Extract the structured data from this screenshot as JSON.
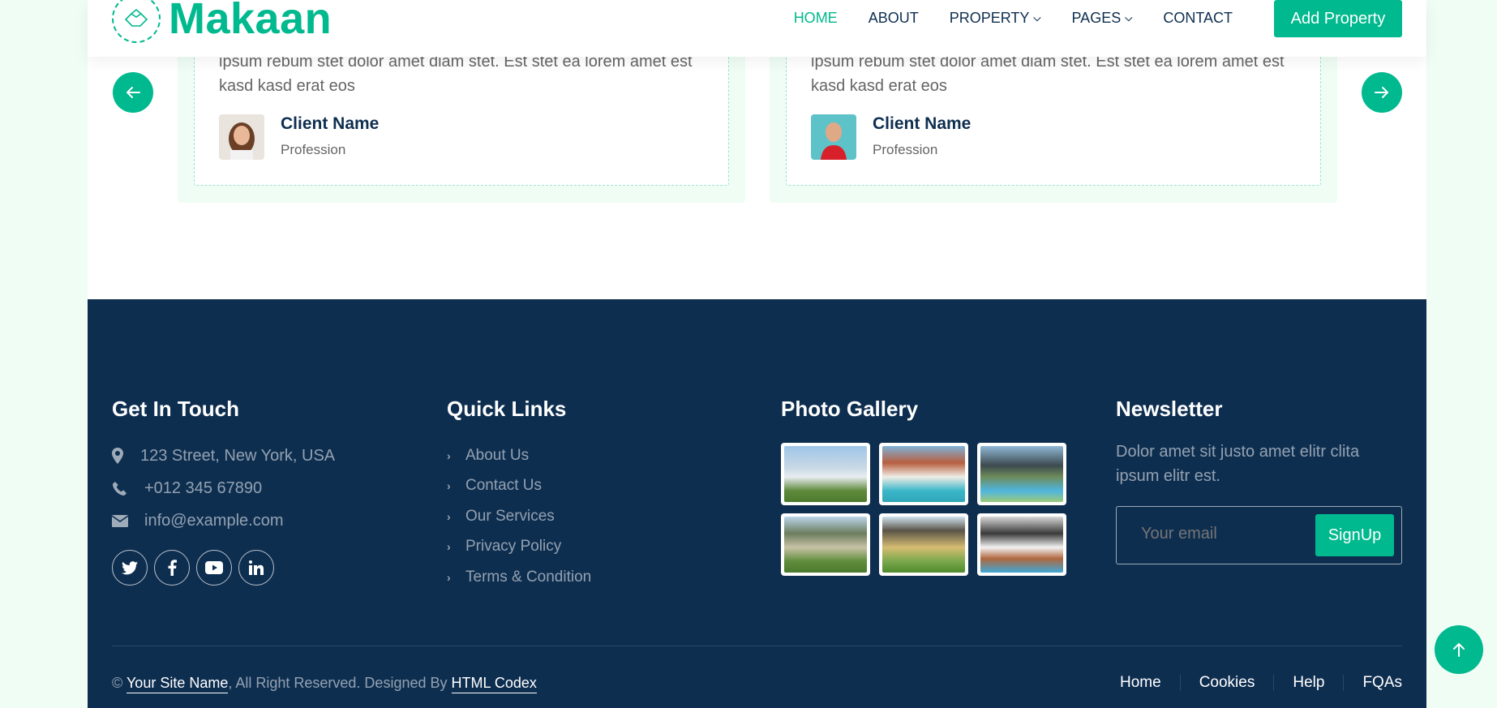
{
  "brand": {
    "name": "Makaan"
  },
  "nav": {
    "links": [
      "HOME",
      "ABOUT",
      "PROPERTY",
      "PAGES",
      "CONTACT"
    ],
    "add_property": "Add Property"
  },
  "testimonials": [
    {
      "text": "ipsum rebum stet dolor amet diam stet. Est stet ea lorem amet est kasd kasd erat eos",
      "name": "Client Name",
      "profession": "Profession"
    },
    {
      "text": "ipsum rebum stet dolor amet diam stet. Est stet ea lorem amet est kasd kasd erat eos",
      "name": "Client Name",
      "profession": "Profession"
    }
  ],
  "footer": {
    "touch": {
      "title": "Get In Touch",
      "address": "123 Street, New York, USA",
      "phone": "+012 345 67890",
      "email": "info@example.com"
    },
    "links": {
      "title": "Quick Links",
      "items": [
        "About Us",
        "Contact Us",
        "Our Services",
        "Privacy Policy",
        "Terms & Condition"
      ]
    },
    "gallery": {
      "title": "Photo Gallery"
    },
    "newsletter": {
      "title": "Newsletter",
      "text": "Dolor amet sit justo amet elitr clita ipsum elitr est.",
      "placeholder": "Your email",
      "button": "SignUp"
    },
    "copyright": {
      "prefix": "©",
      "site": "Your Site Name",
      "middle": ", All Right Reserved. Designed By",
      "designer": "HTML Codex"
    },
    "menu": [
      "Home",
      "Cookies",
      "Help",
      "FQAs"
    ]
  },
  "colors": {
    "primary": "#00b98e",
    "dark": "#0e2e50",
    "light": "#effdf5"
  }
}
